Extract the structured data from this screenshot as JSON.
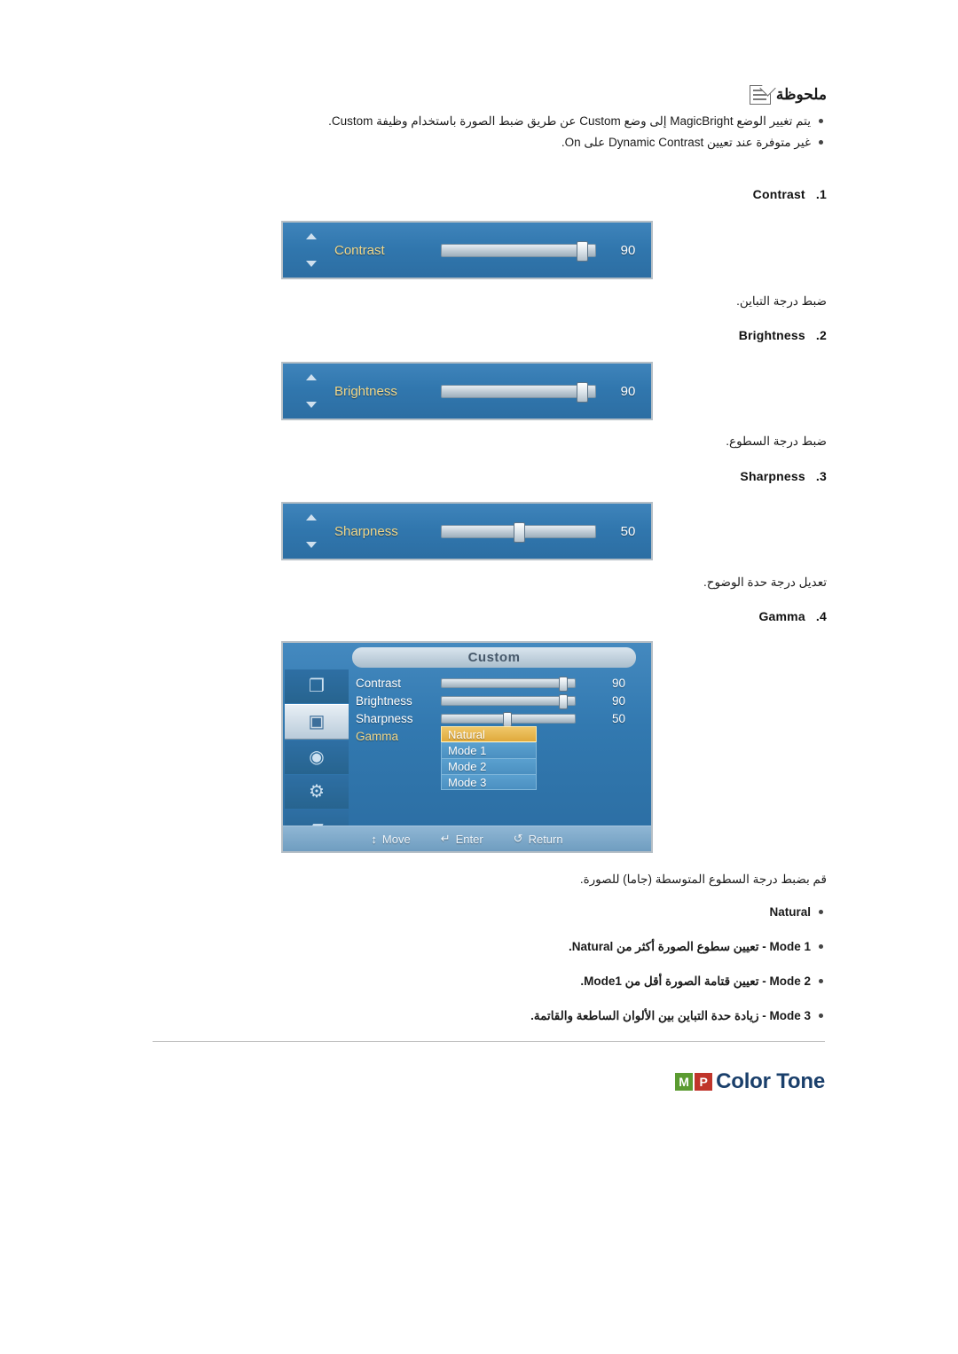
{
  "note": {
    "title": "ملحوظة",
    "icon": "note-icon",
    "bullets": [
      "يتم تغيير الوضع MagicBright إلى وضع Custom عن طريق ضبط الصورة باستخدام وظيفة Custom.",
      "غير متوفرة عند تعيين Dynamic Contrast على On."
    ]
  },
  "items": [
    {
      "num": "1.",
      "label": "Contrast",
      "caption": "ضبط درجة التباين."
    },
    {
      "num": "2.",
      "label": "Brightness",
      "caption": "ضبط درجة السطوع."
    },
    {
      "num": "3.",
      "label": "Sharpness",
      "caption": "تعديل درجة حدة الوضوح."
    },
    {
      "num": "4.",
      "label": "Gamma",
      "caption": "قم بضبط درجة السطوع المتوسطة (جاما) للصورة."
    }
  ],
  "osd_sliders": [
    {
      "name": "Contrast",
      "value": "90",
      "fill": 90
    },
    {
      "name": "Brightness",
      "value": "90",
      "fill": 90
    },
    {
      "name": "Sharpness",
      "value": "50",
      "fill": 50
    }
  ],
  "osd_custom": {
    "title": "Custom",
    "side_icons": [
      {
        "name": "input-source-icon",
        "glyph": "❐"
      },
      {
        "name": "picture-icon",
        "glyph": "▣"
      },
      {
        "name": "sound-icon",
        "glyph": "◉"
      },
      {
        "name": "setup-icon",
        "glyph": "⚙"
      },
      {
        "name": "multi-control-icon",
        "glyph": "▰"
      }
    ],
    "rows": [
      {
        "label": "Contrast",
        "value": "90",
        "fill": 90
      },
      {
        "label": "Brightness",
        "value": "90",
        "fill": 90
      },
      {
        "label": "Sharpness",
        "value": "50",
        "fill": 50
      }
    ],
    "gamma_label": "Gamma",
    "gamma_options": [
      "Natural",
      "Mode 1",
      "Mode 2",
      "Mode 3"
    ],
    "gamma_selected": "Natural",
    "footer": [
      {
        "icon": "↕",
        "label": "Move"
      },
      {
        "icon": "↵",
        "label": "Enter"
      },
      {
        "icon": "↺",
        "label": "Return"
      }
    ]
  },
  "gamma_bullets": [
    "Natural",
    "Mode 1 - تعيين سطوع الصورة أكثر من Natural.",
    "Mode 2 - تعيين قتامة الصورة أقل من Mode1.",
    "Mode 3 - زيادة حدة التباين بين الألوان الساطعة والقاتمة."
  ],
  "section": {
    "badge_m": "M",
    "badge_p": "P",
    "title": "Color Tone"
  }
}
